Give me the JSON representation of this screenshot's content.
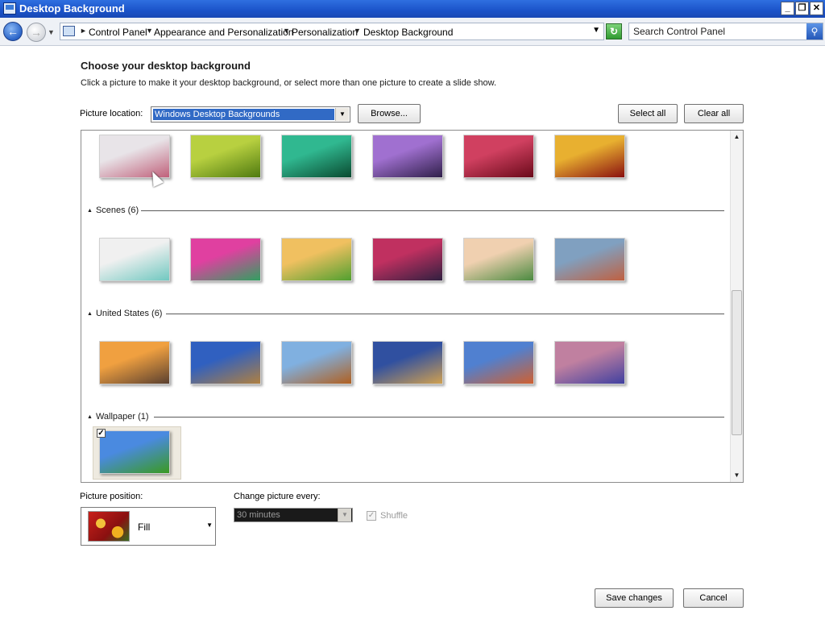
{
  "window": {
    "title": "Desktop Background",
    "minimize": "_",
    "maximize": "❐",
    "close": "✕"
  },
  "addressbar": {
    "breadcrumbs": [
      "Control Panel",
      "Appearance and Personalization",
      "Personalization",
      "Desktop Background"
    ],
    "search_placeholder": "Search Control Panel"
  },
  "header": {
    "title": "Choose your desktop background",
    "subtitle": "Click a picture to make it your desktop background, or select more than one picture to create a slide show."
  },
  "location": {
    "label": "Picture location:",
    "selected": "Windows Desktop Backgrounds",
    "browse_label": "Browse...",
    "select_all_label": "Select all",
    "clear_all_label": "Clear all"
  },
  "groups": [
    {
      "label": "Scenes (6)"
    },
    {
      "label": "United States (6)"
    },
    {
      "label": "Wallpaper (1)"
    }
  ],
  "thumb_colors": {
    "nature": [
      [
        "#e8e4e8",
        "#c0607a"
      ],
      [
        "#b8d040",
        "#4f7a10"
      ],
      [
        "#30b890",
        "#0a4a30"
      ],
      [
        "#a070d0",
        "#30204a"
      ],
      [
        "#d04060",
        "#6a0a1a"
      ],
      [
        "#e8b030",
        "#8a1010"
      ]
    ],
    "scenes": [
      [
        "#f0f0f0",
        "#70c8c0"
      ],
      [
        "#e040a0",
        "#30a060"
      ],
      [
        "#f0c060",
        "#50a030"
      ],
      [
        "#c03060",
        "#302040"
      ],
      [
        "#f0d0b0",
        "#4a8a40"
      ],
      [
        "#80a0c0",
        "#c06040"
      ]
    ],
    "us": [
      [
        "#f0a040",
        "#5a4030"
      ],
      [
        "#3060c0",
        "#b08040"
      ],
      [
        "#80b0e0",
        "#b06020"
      ],
      [
        "#3050a0",
        "#d0a050"
      ],
      [
        "#5080d0",
        "#d06030"
      ],
      [
        "#c080a0",
        "#4040a0"
      ]
    ],
    "wallpaper": [
      [
        "#4a8ae0",
        "#3a9a20"
      ]
    ]
  },
  "wallpaper_checked": "✓",
  "position": {
    "label": "Picture position:",
    "value": "Fill"
  },
  "interval": {
    "label": "Change picture every:",
    "value": "30 minutes"
  },
  "shuffle": {
    "label": "Shuffle",
    "check": "✓"
  },
  "footer": {
    "save_label": "Save changes",
    "cancel_label": "Cancel"
  }
}
